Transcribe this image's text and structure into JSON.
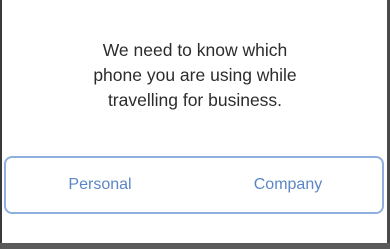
{
  "dialog": {
    "message_lines": [
      "We need to know which",
      "phone you are using while",
      "travelling for business."
    ],
    "options": [
      "Personal",
      "Company"
    ],
    "accent_color": "#5b86c6",
    "border_color": "#8fb0de"
  }
}
